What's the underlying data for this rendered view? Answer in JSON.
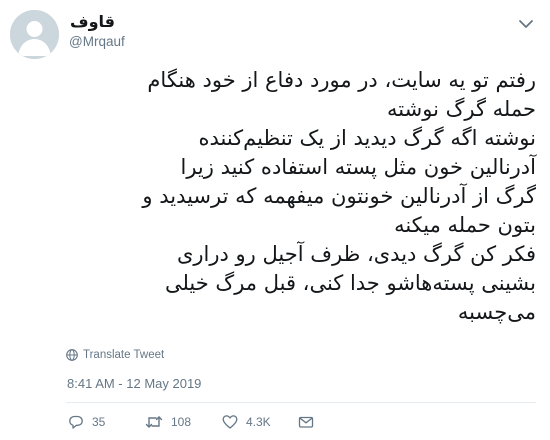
{
  "author": {
    "display_name": "قاوف",
    "handle": "@Mrqauf"
  },
  "tweet": {
    "lines": [
      "رفتم تو یه سایت، در مورد دفاع از خود هنگام",
      "حمله گرگ نوشته",
      "نوشته اگه گرگ دیدید از یک تنظیم‌کننده",
      "آدرنالین خون مثل پسته استفاده کنید زیرا",
      "گرگ از آدرنالین خونتون میفهمه که ترسیدید و",
      "بتون حمله میکنه",
      "فکر کن گرگ دیدی، ظرف آجیل رو دراری",
      "بشینی پسته‌هاشو جدا کنی، قبل مرگ خیلی",
      "می‌چسبه"
    ],
    "translate_label": "Translate Tweet",
    "timestamp": "8:41 AM - 12 May 2019"
  },
  "actions": {
    "replies": "35",
    "retweets": "108",
    "likes": "4.3K"
  },
  "icons": {
    "caret": "chevron-down-icon",
    "globe": "globe-icon",
    "reply": "reply-icon",
    "retweet": "retweet-icon",
    "like": "heart-icon",
    "message": "envelope-icon"
  },
  "colors": {
    "text": "#14171a",
    "secondary": "#657786",
    "avatar_bg": "#ccd6dd",
    "divider": "#e6ecf0"
  }
}
